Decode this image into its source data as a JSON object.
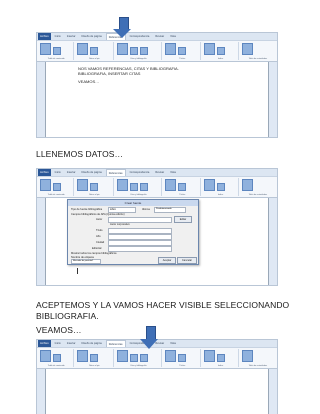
{
  "ribbon": {
    "tabs": [
      "Archivo",
      "Inicio",
      "Insertar",
      "Diseño de página",
      "Referencias",
      "Correspondencia",
      "Revisar",
      "Vista"
    ],
    "active_tab": "Referencias",
    "groups": [
      "Tabla de contenido",
      "Notas al pie",
      "Citas y bibliografía",
      "Títulos",
      "Índice",
      "Tabla de autoridades"
    ]
  },
  "shot1": {
    "doc_lines": [
      "NOS VAMOS REFERENCIAS, CITAS Y BIBLIOGRAFIA.",
      "BIBLIOGRAFIA, INSERTAR CITAS",
      "VEAMOS…"
    ]
  },
  "caption1": "LLENEMOS DATOS…",
  "dialog": {
    "title": "Crear fuente",
    "type_label": "Tipo de fuente bibliográfica",
    "type_value": "Libro",
    "lang_label": "Idioma",
    "lang_value": "Predeterminado",
    "subtitle": "Campos bibliográficos de APA (Quinta edición)",
    "fields": [
      "Autor",
      "Título",
      "Año",
      "Ciudad",
      "Editorial"
    ],
    "author_hint": "Autor corporativo",
    "edit_label": "Editar",
    "show_all": "Mostrar todos los campos bibliográficos",
    "tag_label": "Nombre de etiqueta",
    "tag_value": "Marcador de posición1",
    "ok": "Aceptar",
    "cancel": "Cancelar"
  },
  "caption2": "ACEPTEMOS Y LA VAMOS HACER VISIBLE SELECCIONANDO BIBLIOGRAFIA.",
  "caption3": "VEAMOS…",
  "colors": {
    "accent": "#3f6fb6",
    "file_tab": "#2b5797"
  }
}
